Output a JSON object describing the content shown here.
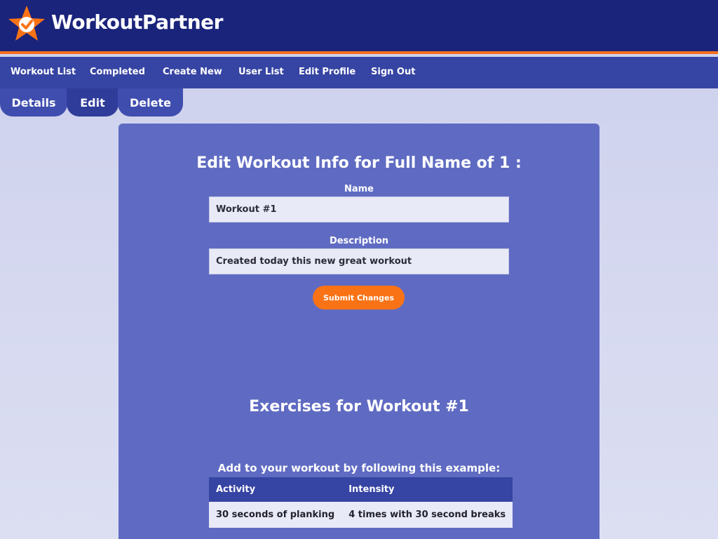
{
  "app": {
    "brand": "WorkoutPartner",
    "logo_icon": "star-check-icon",
    "accent": "#f97316",
    "primary": "#1b247b"
  },
  "nav": {
    "items": [
      {
        "label": "Workout List"
      },
      {
        "label": "Completed"
      },
      {
        "label": "Create New"
      },
      {
        "label": "User List"
      },
      {
        "label": "Edit Profile"
      },
      {
        "label": "Sign Out"
      }
    ]
  },
  "subtabs": {
    "details": "Details",
    "edit": "Edit",
    "delete": "Delete"
  },
  "form": {
    "title": "Edit Workout Info for Full Name of 1 :",
    "name_label": "Name",
    "name_value": "Workout #1",
    "description_label": "Description",
    "description_value": "Created today this new great workout",
    "submit_label": "Submit Changes"
  },
  "exercises": {
    "title": "Exercises for Workout #1",
    "hint": "Add to your workout by following this example:",
    "columns": [
      "Activity",
      "Intensity"
    ],
    "rows": [
      [
        "30 seconds of planking",
        "4 times with 30 second breaks"
      ]
    ]
  }
}
